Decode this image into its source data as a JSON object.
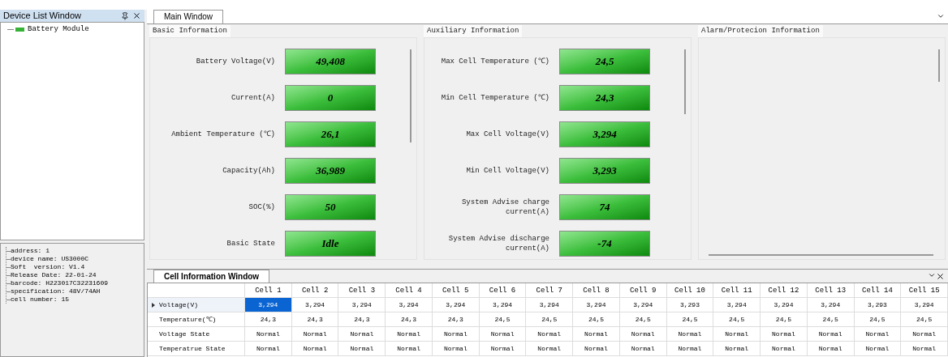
{
  "device_list": {
    "title": "Device List Window",
    "items": [
      {
        "label": "Battery Module"
      }
    ]
  },
  "device_info": [
    "address: 1",
    "device name: US3000C",
    "Soft  version: V1.4",
    "Release Date: 22-01-24",
    "barcode: H223017C32231609",
    "specification: 48V/74AH",
    "cell number: 15"
  ],
  "main_tabs": [
    {
      "label": "Main Window",
      "selected": true
    }
  ],
  "groups": [
    {
      "title": "Basic Information",
      "fields": [
        {
          "label": "Battery Voltage(V)",
          "value": "49,408"
        },
        {
          "label": "Current(A)",
          "value": "0"
        },
        {
          "label": "Ambient Temperature (℃)",
          "value": "26,1"
        },
        {
          "label": "Capacity(Ah)",
          "value": "36,989"
        },
        {
          "label": "SOC(%)",
          "value": "50"
        },
        {
          "label": "Basic State",
          "value": "Idle"
        }
      ]
    },
    {
      "title": "Auxiliary Information",
      "fields": [
        {
          "label": "Max Cell Temperature (℃)",
          "value": "24,5"
        },
        {
          "label": "Min Cell Temperature (℃)",
          "value": "24,3"
        },
        {
          "label": "Max Cell Voltage(V)",
          "value": "3,294"
        },
        {
          "label": "Min Cell Voltage(V)",
          "value": "3,293"
        },
        {
          "label": "System Advise charge current(A)",
          "value": "74"
        },
        {
          "label": "System Advise discharge current(A)",
          "value": "-74"
        }
      ]
    },
    {
      "title": "Alarm/Protecion Information"
    }
  ],
  "cell_window": {
    "title": "Cell Information Window",
    "columns": [
      "Cell 1",
      "Cell 2",
      "Cell 3",
      "Cell 4",
      "Cell 5",
      "Cell 6",
      "Cell 7",
      "Cell 8",
      "Cell 9",
      "Cell 10",
      "Cell 11",
      "Cell 12",
      "Cell 13",
      "Cell 14",
      "Cell 15"
    ],
    "rows": [
      {
        "label": "Voltage(V)",
        "selected": true,
        "cells": [
          {
            "text": "3,294",
            "selected": true
          },
          {
            "text": "3,294",
            "selected": false
          },
          {
            "text": "3,294",
            "selected": false
          },
          {
            "text": "3,294",
            "selected": false
          },
          {
            "text": "3,294",
            "selected": false
          },
          {
            "text": "3,294",
            "selected": false
          },
          {
            "text": "3,294",
            "selected": false
          },
          {
            "text": "3,294",
            "selected": false
          },
          {
            "text": "3,294",
            "selected": false
          },
          {
            "text": "3,293",
            "selected": false
          },
          {
            "text": "3,294",
            "selected": false
          },
          {
            "text": "3,294",
            "selected": false
          },
          {
            "text": "3,294",
            "selected": false
          },
          {
            "text": "3,293",
            "selected": false
          },
          {
            "text": "3,294",
            "selected": false
          }
        ]
      },
      {
        "label": "Temperature(℃)",
        "selected": false,
        "cells": [
          {
            "text": "24,3",
            "selected": false
          },
          {
            "text": "24,3",
            "selected": false
          },
          {
            "text": "24,3",
            "selected": false
          },
          {
            "text": "24,3",
            "selected": false
          },
          {
            "text": "24,3",
            "selected": false
          },
          {
            "text": "24,5",
            "selected": false
          },
          {
            "text": "24,5",
            "selected": false
          },
          {
            "text": "24,5",
            "selected": false
          },
          {
            "text": "24,5",
            "selected": false
          },
          {
            "text": "24,5",
            "selected": false
          },
          {
            "text": "24,5",
            "selected": false
          },
          {
            "text": "24,5",
            "selected": false
          },
          {
            "text": "24,5",
            "selected": false
          },
          {
            "text": "24,5",
            "selected": false
          },
          {
            "text": "24,5",
            "selected": false
          }
        ]
      },
      {
        "label": "Voltage State",
        "selected": false,
        "cells": [
          {
            "text": "Normal",
            "selected": false
          },
          {
            "text": "Normal",
            "selected": false
          },
          {
            "text": "Normal",
            "selected": false
          },
          {
            "text": "Normal",
            "selected": false
          },
          {
            "text": "Normal",
            "selected": false
          },
          {
            "text": "Normal",
            "selected": false
          },
          {
            "text": "Normal",
            "selected": false
          },
          {
            "text": "Normal",
            "selected": false
          },
          {
            "text": "Normal",
            "selected": false
          },
          {
            "text": "Normal",
            "selected": false
          },
          {
            "text": "Normal",
            "selected": false
          },
          {
            "text": "Normal",
            "selected": false
          },
          {
            "text": "Normal",
            "selected": false
          },
          {
            "text": "Normal",
            "selected": false
          },
          {
            "text": "Normal",
            "selected": false
          }
        ]
      },
      {
        "label": "Temperatrue State",
        "selected": false,
        "cells": [
          {
            "text": "Normal",
            "selected": false
          },
          {
            "text": "Normal",
            "selected": false
          },
          {
            "text": "Normal",
            "selected": false
          },
          {
            "text": "Normal",
            "selected": false
          },
          {
            "text": "Normal",
            "selected": false
          },
          {
            "text": "Normal",
            "selected": false
          },
          {
            "text": "Normal",
            "selected": false
          },
          {
            "text": "Normal",
            "selected": false
          },
          {
            "text": "Normal",
            "selected": false
          },
          {
            "text": "Normal",
            "selected": false
          },
          {
            "text": "Normal",
            "selected": false
          },
          {
            "text": "Normal",
            "selected": false
          },
          {
            "text": "Normal",
            "selected": false
          },
          {
            "text": "Normal",
            "selected": false
          },
          {
            "text": "Normal",
            "selected": false
          }
        ]
      }
    ]
  }
}
